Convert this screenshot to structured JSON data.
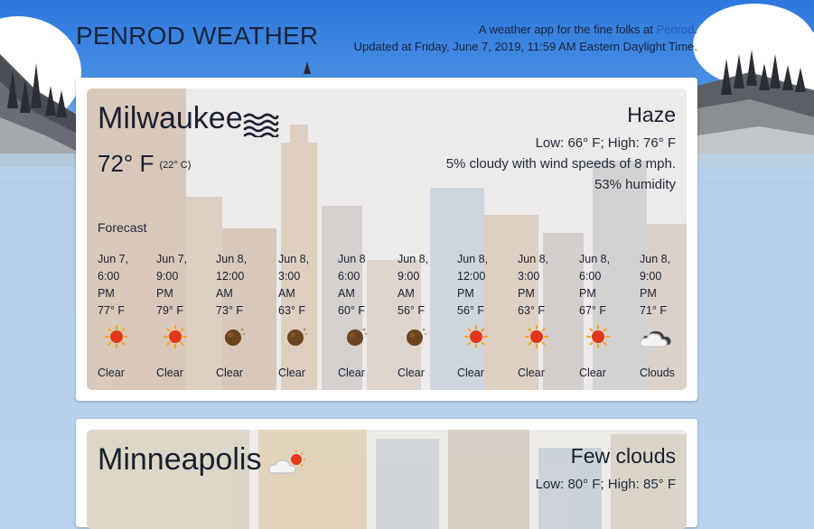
{
  "app": {
    "title": "PENROD WEATHER",
    "tagline_prefix": "A weather app for the fine folks at ",
    "tagline_link": "Penrod",
    "tagline_suffix": ".",
    "updated": "Updated at Friday, June 7, 2019, 11:59 AM Eastern Daylight Time."
  },
  "cities": [
    {
      "name": "Milwaukee",
      "icon": "haze-icon",
      "temp_f": "72° F",
      "temp_c": "(22° C)",
      "description": "Haze",
      "low_high": "Low: 66° F; High: 76° F",
      "clouds_wind": "5% cloudy with wind speeds of 8 mph.",
      "humidity": "53% humidity",
      "forecast_label": "Forecast",
      "forecast": [
        {
          "date": "Jun 7,",
          "time": "6:00",
          "ampm": "PM",
          "temp": "77° F",
          "icon": "sun-icon",
          "cond": "Clear"
        },
        {
          "date": "Jun 7,",
          "time": "9:00",
          "ampm": "PM",
          "temp": "79° F",
          "icon": "sun-icon",
          "cond": "Clear"
        },
        {
          "date": "Jun 8,",
          "time": "12:00",
          "ampm": "AM",
          "temp": "73° F",
          "icon": "moon-icon",
          "cond": "Clear"
        },
        {
          "date": "Jun 8,",
          "time": "3:00",
          "ampm": "AM",
          "temp": "63° F",
          "icon": "moon-icon",
          "cond": "Clear"
        },
        {
          "date": "Jun 8",
          "time": "6:00",
          "ampm": "AM",
          "temp": "60° F",
          "icon": "moon-icon",
          "cond": "Clear"
        },
        {
          "date": "Jun 8,",
          "time": "9:00",
          "ampm": "AM",
          "temp": "56° F",
          "icon": "moon-icon",
          "cond": "Clear"
        },
        {
          "date": "Jun 8,",
          "time": "12:00",
          "ampm": "PM",
          "temp": "56° F",
          "icon": "sun-icon",
          "cond": "Clear"
        },
        {
          "date": "Jun 8,",
          "time": "3:00",
          "ampm": "PM",
          "temp": "63° F",
          "icon": "sun-icon",
          "cond": "Clear"
        },
        {
          "date": "Jun 8,",
          "time": "6:00",
          "ampm": "PM",
          "temp": "67° F",
          "icon": "sun-icon",
          "cond": "Clear"
        },
        {
          "date": "Jun 8,",
          "time": "9:00",
          "ampm": "PM",
          "temp": "71° F",
          "icon": "clouds-icon",
          "cond": "Clouds"
        }
      ]
    },
    {
      "name": "Minneapolis",
      "icon": "few-clouds-icon",
      "description": "Few clouds",
      "low_high": "Low: 80° F; High: 85° F"
    }
  ],
  "colors": {
    "sky_top": "#2b74d9",
    "sky_bottom": "#b9d3ec",
    "link": "#1b5fb8",
    "text": "#1a2030"
  }
}
